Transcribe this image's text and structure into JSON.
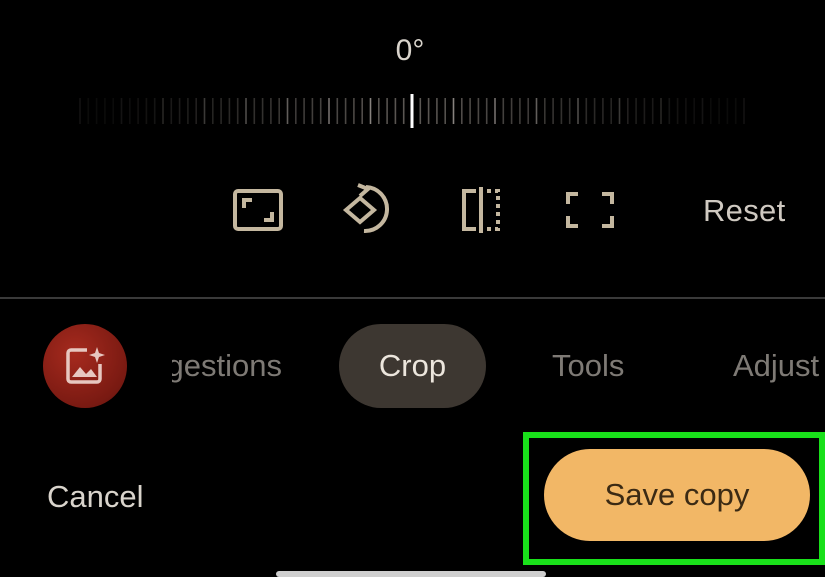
{
  "rotation": {
    "angle_label": "0°",
    "value_degrees": 0
  },
  "toolbar": {
    "aspect_ratio_icon": "aspect-ratio-icon",
    "rotate_icon": "rotate-icon",
    "flip_icon": "flip-icon",
    "free_crop_icon": "free-crop-icon",
    "reset_label": "Reset"
  },
  "tabs": {
    "ai_icon": "ai-photo-icon",
    "suggestions_label": "Suggestions",
    "crop_label": "Crop",
    "tools_label": "Tools",
    "adjust_label": "Adjust"
  },
  "actions": {
    "cancel_label": "Cancel",
    "save_label": "Save copy"
  },
  "colors": {
    "background": "#000000",
    "accent": "#f2b766",
    "icon": "#c4b79f",
    "highlight_frame": "#19e01a",
    "active_tab": "#3d3731"
  }
}
